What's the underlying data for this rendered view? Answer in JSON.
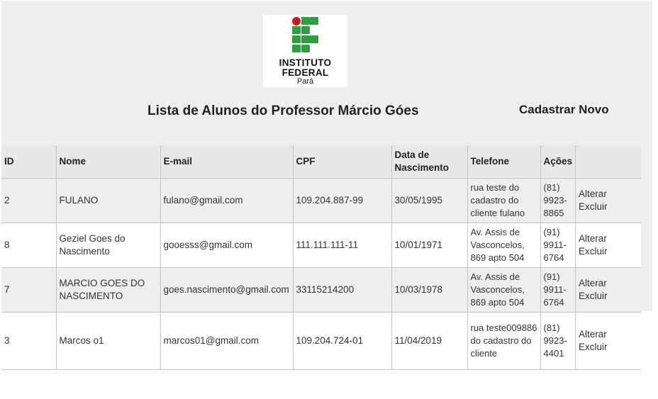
{
  "header": {
    "logo": {
      "line1": "INSTITUTO",
      "line2": "FEDERAL",
      "line3": "Pará",
      "colors": {
        "green": "#2f9e41",
        "red": "#cd191e"
      }
    },
    "title": "Lista de Alunos do Professor Márcio Góes",
    "new_link": "Cadastrar Novo"
  },
  "table": {
    "columns": [
      "ID",
      "Nome",
      "E-mail",
      "CPF",
      "Data de Nascimento",
      "Telefone",
      "Ações",
      ""
    ],
    "rows": [
      {
        "id": "2",
        "nome": "FULANO",
        "email": "fulano@gmail.com",
        "cpf": "109.204.887-99",
        "nascimento": "30/05/1995",
        "endereco": "rua teste do cadastro do cliente fulano",
        "telefone": "(81) 9923-8865",
        "alterar": "Alterar",
        "excluir": "Excluir"
      },
      {
        "id": "8",
        "nome": "Geziel Goes do Nascimento",
        "email": "gooesss@gmail.com",
        "cpf": "111.111.111-11",
        "nascimento": "10/01/1971",
        "endereco": "Av. Assis de Vasconcelos, 869 apto 504",
        "telefone": "(91) 9911-6764",
        "alterar": "Alterar",
        "excluir": "Excluir"
      },
      {
        "id": "7",
        "nome": "MARCIO GOES DO NASCIMENTO",
        "email": "goes.nascimento@gmail.com",
        "cpf": "33115214200",
        "nascimento": "10/03/1978",
        "endereco": "Av. Assis de Vasconcelos, 869 apto 504",
        "telefone": "(91) 9911-6764",
        "alterar": "Alterar",
        "excluir": "Excluir"
      },
      {
        "id": "3",
        "nome": "Marcos o1",
        "email": "marcos01@gmail.com",
        "cpf": "109.204.724-01",
        "nascimento": "11/04/2019",
        "endereco": "rua teste009886 do cadastro do cliente",
        "telefone": "(81) 9923-4401",
        "alterar": "Alterar",
        "excluir": "Excluir"
      }
    ]
  }
}
